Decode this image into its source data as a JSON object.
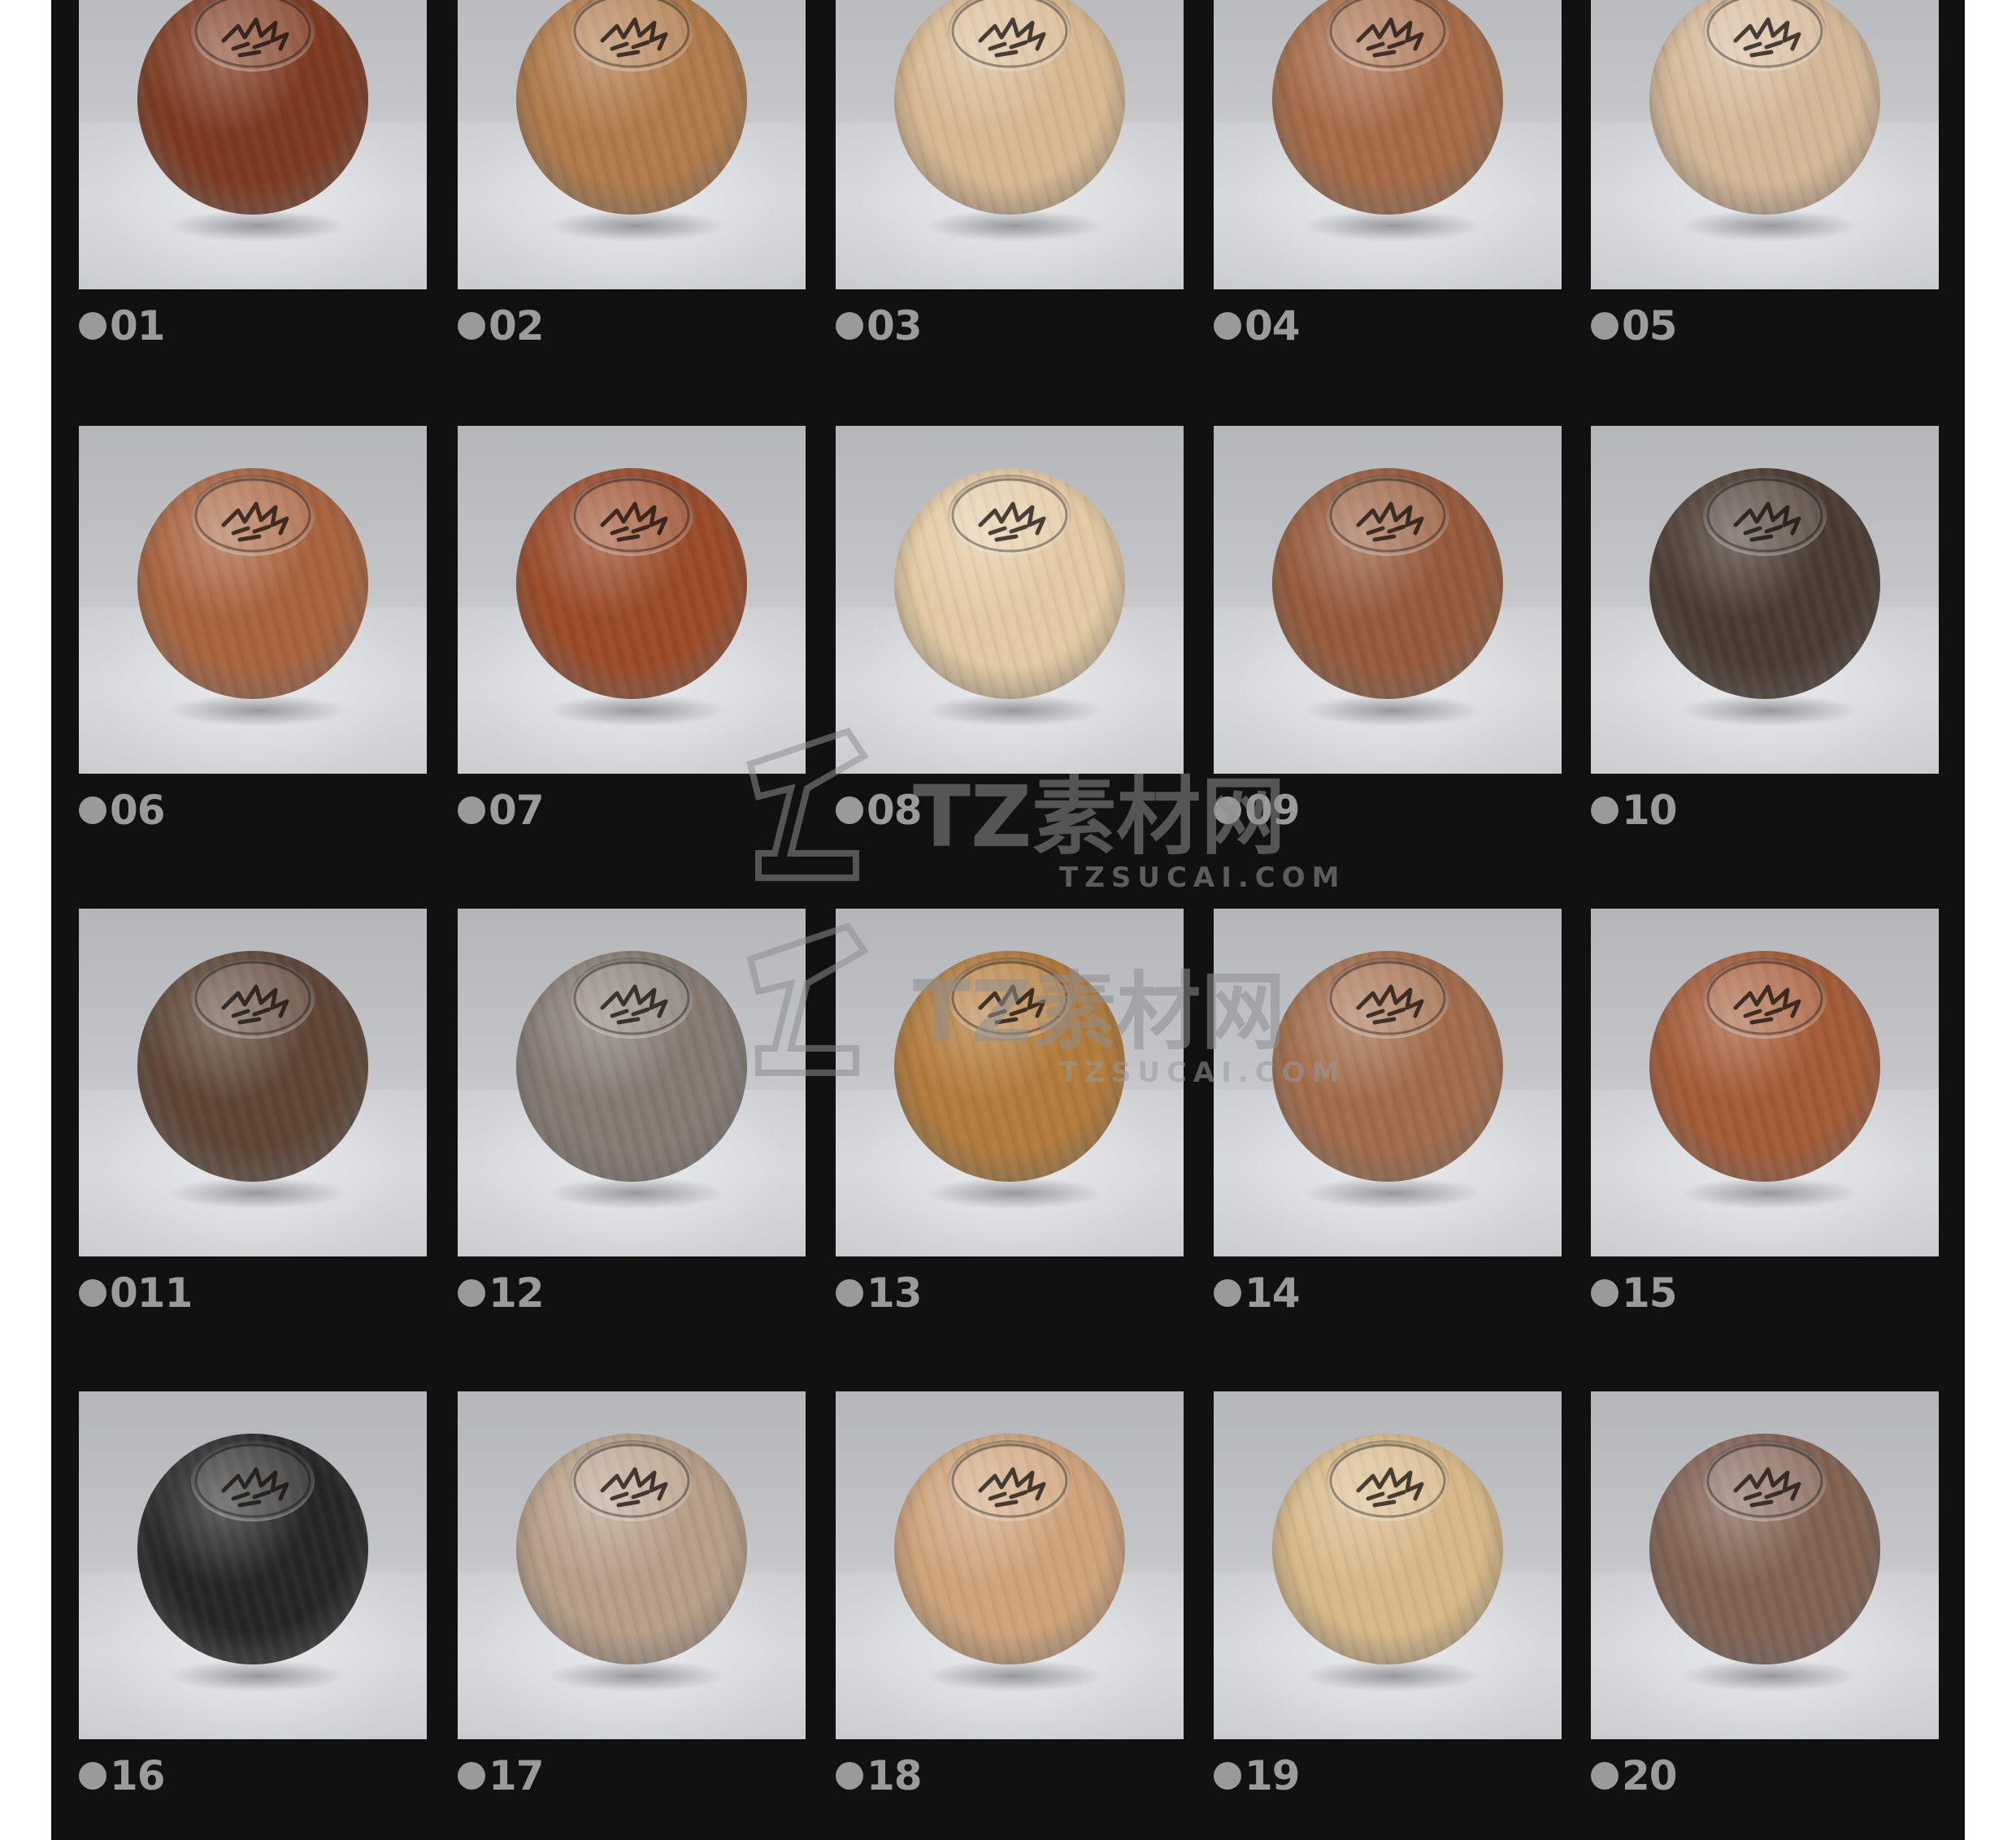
{
  "swatches": [
    {
      "label": "01",
      "color": "#7e3a20"
    },
    {
      "label": "02",
      "color": "#b07a4a"
    },
    {
      "label": "03",
      "color": "#d8b890"
    },
    {
      "label": "04",
      "color": "#a66b47"
    },
    {
      "label": "05",
      "color": "#d5b797"
    },
    {
      "label": "06",
      "color": "#a9633e"
    },
    {
      "label": "07",
      "color": "#9a4a28"
    },
    {
      "label": "08",
      "color": "#e3c9a2"
    },
    {
      "label": "09",
      "color": "#965a3a"
    },
    {
      "label": "10",
      "color": "#4a3a30"
    },
    {
      "label": "011",
      "color": "#5e4636"
    },
    {
      "label": "12",
      "color": "#857a72"
    },
    {
      "label": "13",
      "color": "#b27a3a"
    },
    {
      "label": "14",
      "color": "#a26c4a"
    },
    {
      "label": "15",
      "color": "#a45a36"
    },
    {
      "label": "16",
      "color": "#262626"
    },
    {
      "label": "17",
      "color": "#b79e88"
    },
    {
      "label": "18",
      "color": "#cfa37a"
    },
    {
      "label": "19",
      "color": "#d8b888"
    },
    {
      "label": "20",
      "color": "#826252"
    }
  ],
  "watermark": {
    "text": "TZ素材网",
    "url": "TZSUCAI.COM"
  }
}
